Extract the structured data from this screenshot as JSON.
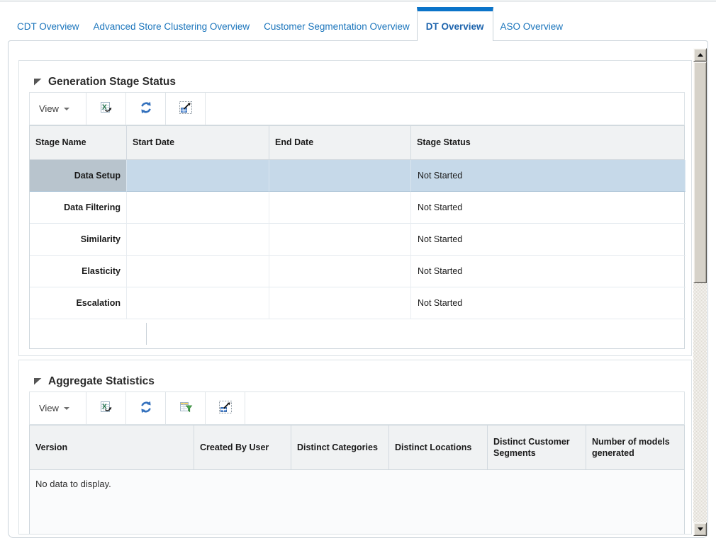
{
  "tabs": {
    "items": [
      {
        "label": "CDT Overview",
        "active": false
      },
      {
        "label": "Advanced Store Clustering Overview",
        "active": false
      },
      {
        "label": "Customer Segmentation Overview",
        "active": false
      },
      {
        "label": "DT Overview",
        "active": true
      },
      {
        "label": "ASO Overview",
        "active": false
      }
    ]
  },
  "generation_stage_status": {
    "title": "Generation Stage Status",
    "toolbar": {
      "view_label": "View",
      "icons": [
        "export-to-excel-icon",
        "refresh-icon",
        "detach-icon"
      ]
    },
    "columns": {
      "stage_name": "Stage Name",
      "start_date": "Start Date",
      "end_date": "End Date",
      "stage_status": "Stage Status"
    },
    "rows": [
      {
        "name": "Data Setup",
        "start": "",
        "end": "",
        "status": "Not Started",
        "selected": true
      },
      {
        "name": "Data Filtering",
        "start": "",
        "end": "",
        "status": "Not Started",
        "selected": false
      },
      {
        "name": "Similarity",
        "start": "",
        "end": "",
        "status": "Not Started",
        "selected": false
      },
      {
        "name": "Elasticity",
        "start": "",
        "end": "",
        "status": "Not Started",
        "selected": false
      },
      {
        "name": "Escalation",
        "start": "",
        "end": "",
        "status": "Not Started",
        "selected": false
      }
    ]
  },
  "aggregate_statistics": {
    "title": "Aggregate Statistics",
    "toolbar": {
      "view_label": "View",
      "icons": [
        "export-to-excel-icon",
        "refresh-icon",
        "query-by-example-icon",
        "detach-icon"
      ]
    },
    "columns": {
      "version": "Version",
      "created_by": "Created By User",
      "categories": "Distinct Categories",
      "locations": "Distinct Locations",
      "segments": "Distinct Customer Segments",
      "models": "Number of models generated"
    },
    "empty_message": "No data to display."
  },
  "colors": {
    "accent_blue": "#0b74c9",
    "tab_text_blue": "#1b75bc",
    "active_tab_text": "#1d64ad",
    "selected_row": "#c6d9e9",
    "selected_row_name_cell": "#b8c4cd",
    "table_header_bg": "#f0f2f3",
    "scrollbar_face": "#d6d2c9"
  }
}
